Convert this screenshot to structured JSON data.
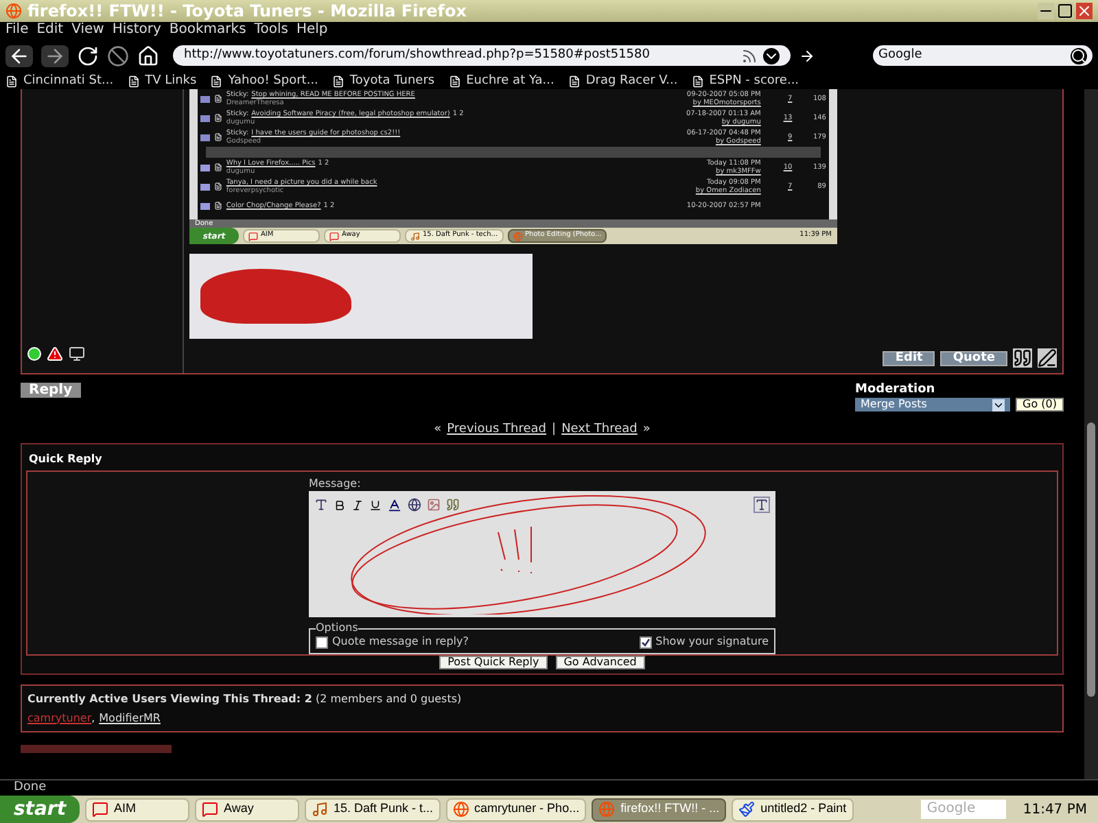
{
  "window": {
    "title": "firefox!! FTW!! - Toyota Tuners - Mozilla Firefox"
  },
  "menu": [
    "File",
    "Edit",
    "View",
    "History",
    "Bookmarks",
    "Tools",
    "Help"
  ],
  "address_bar": {
    "value": "http://www.toyotatuners.com/forum/showthread.php?p=51580#post51580"
  },
  "search": {
    "value": "Google"
  },
  "bookmarks": [
    "Cincinnati St...",
    "TV Links",
    "Yahoo! Sport...",
    "Toyota Tuners",
    "Euchre at Ya...",
    "Drag Racer V...",
    "ESPN - score..."
  ],
  "embedded_screenshot": {
    "threads": [
      {
        "kind": "sticky",
        "prefix": "Sticky:",
        "title": "Stop whining, READ ME BEFORE POSTING HERE",
        "author": "DreamerTheresa",
        "date": "09-20-2007 05:08 PM",
        "last_by": "by MEOmotorsports",
        "replies": "7",
        "views": "108"
      },
      {
        "kind": "sticky",
        "prefix": "Sticky:",
        "title": "Avoiding Software Piracy (free, legal photoshop emulator)",
        "pages": "1 2",
        "author": "dugumu",
        "date": "07-18-2007 01:13 AM",
        "last_by": "by dugumu",
        "replies": "13",
        "views": "146"
      },
      {
        "kind": "sticky",
        "prefix": "Sticky:",
        "title": "I have the users guide for photoshop cs2!!!",
        "author": "Godspeed",
        "date": "06-17-2007 04:48 PM",
        "last_by": "by Godspeed",
        "replies": "9",
        "views": "179"
      },
      {
        "kind": "separator"
      },
      {
        "kind": "normal",
        "title": "Why I Love Firefox..... Pics",
        "pages": "1 2",
        "author": "dugumu",
        "date": "Today 11:08 PM",
        "last_by": "by mk3MFFw",
        "replies": "10",
        "views": "139"
      },
      {
        "kind": "normal",
        "title": "Tanya, I need a picture you did a while back",
        "author": "foreverpsychotic",
        "date": "Today 09:08 PM",
        "last_by": "by Omen Zodiacen",
        "replies": "7",
        "views": "89"
      },
      {
        "kind": "normal",
        "title": "Color Chop/Change Please?",
        "pages": "1 2",
        "date": "10-20-2007 02:57 PM"
      }
    ],
    "status": "Done",
    "start": "start",
    "taskbar": [
      {
        "label": "AIM",
        "kind": "aim",
        "selected": false
      },
      {
        "label": "Away",
        "kind": "aim",
        "selected": false
      },
      {
        "label": "15. Daft Punk - tech...",
        "kind": "media",
        "selected": false
      },
      {
        "label": "Photo Editing (Photo...",
        "kind": "browser",
        "selected": true
      }
    ],
    "clock": "11:39 PM"
  },
  "post_buttons": [
    "Edit",
    "Quote"
  ],
  "reply_button": "Reply",
  "moderation": {
    "title": "Moderation",
    "select": "Merge Posts",
    "go": "Go (0)"
  },
  "thread_nav": {
    "prev": "Previous Thread",
    "next": "Next Thread",
    "left_mark": "«",
    "right_mark": "»",
    "separator": "|"
  },
  "quick_reply": {
    "title": "Quick Reply",
    "message_label": "Message:",
    "options_legend": "Options",
    "options": [
      {
        "label": "Quote message in reply?",
        "checked": false
      },
      {
        "label": "Show your signature",
        "checked": true
      }
    ],
    "buttons": [
      "Post Quick Reply",
      "Go Advanced"
    ]
  },
  "active_users": {
    "title": "**Currently Active Users Viewing This Thread: 2** (2 members and 0 guests)",
    "separator": ",",
    "users": [
      {
        "name": "camrytuner",
        "color": "#cc3333"
      },
      {
        "name": "ModifierMR",
        "color": "#dddddd"
      }
    ]
  },
  "status_bar": "Done",
  "start": "start",
  "taskbar": [
    {
      "label": "AIM",
      "kind": "aim",
      "selected": false
    },
    {
      "label": "Away",
      "kind": "aim",
      "selected": false
    },
    {
      "label": "15. Daft Punk - t...",
      "kind": "media",
      "selected": false
    },
    {
      "label": "camrytuner - Pho...",
      "kind": "browser",
      "selected": false
    },
    {
      "label": "firefox!! FTW!! - ...",
      "kind": "browser",
      "selected": true
    },
    {
      "label": "untitled2 - Paint",
      "kind": "paint",
      "selected": false
    }
  ],
  "tray": {
    "search": "Google",
    "clock": "11:47 PM"
  }
}
